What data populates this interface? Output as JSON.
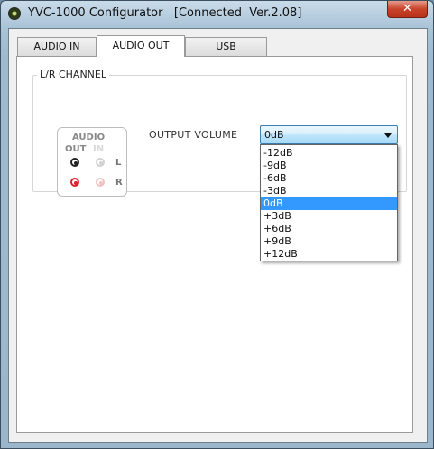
{
  "window": {
    "title": "YVC-1000 Configurator   [Connected  Ver.2.08]",
    "close_label": "✕"
  },
  "tabs": [
    {
      "label": "AUDIO IN",
      "active": false
    },
    {
      "label": "AUDIO OUT",
      "active": true
    },
    {
      "label": "USB",
      "active": false
    }
  ],
  "group": {
    "label": "L/R CHANNEL"
  },
  "audio_box": {
    "title": "AUDIO",
    "out_label": "OUT",
    "in_label": "IN",
    "left_label": "L",
    "right_label": "R"
  },
  "output_volume": {
    "label": "OUTPUT VOLUME",
    "value": "0dB",
    "options": [
      "-12dB",
      "-9dB",
      "-6dB",
      "-3dB",
      "0dB",
      "+3dB",
      "+6dB",
      "+9dB",
      "+12dB"
    ],
    "selected_index": 4
  },
  "colors": {
    "selection": "#3399ff",
    "jack_out_right": "#d8232a",
    "close_button": "#c8432b"
  }
}
